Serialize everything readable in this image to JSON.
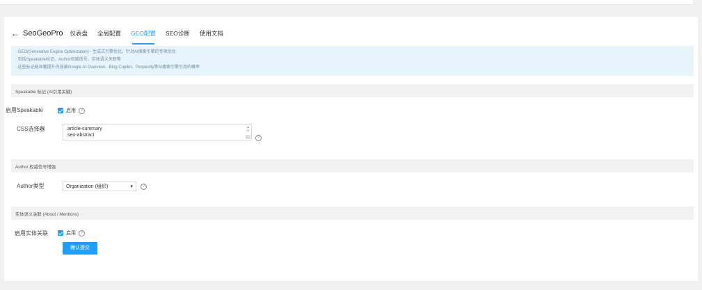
{
  "nav": {
    "back_icon": "←",
    "brand": "SeoGeoPro",
    "tabs": [
      {
        "label": "仪表盘",
        "active": false
      },
      {
        "label": "全局配置",
        "active": false
      },
      {
        "label": "GEO配置",
        "active": true
      },
      {
        "label": "SEO诊断",
        "active": false
      },
      {
        "label": "使用文档",
        "active": false
      }
    ]
  },
  "notice": {
    "lines": [
      "· GEO(Generative Engine Optimization) - 生成式引擎优化，针对AI搜索引擎的专项优化",
      "· 包括Speakable标记、Author权威信号、实体语义关联等",
      "· 这些标记能显著提升内容被Google AI Overview、Bing Copilot、Perplexity等AI搜索引擎引用的概率"
    ]
  },
  "speakable": {
    "section_title": "Speakable 标记 (AI引用关键)",
    "enable_label": "启用Speakable",
    "enable_checked": true,
    "enable_text": "启用",
    "css_label": "CSS选择器",
    "css_lines": [
      ".article-summary",
      ".seo-abstract"
    ]
  },
  "author": {
    "section_title": "Author 权威信号增强",
    "type_label": "Author类型",
    "type_value": "Organization (组织)"
  },
  "entity": {
    "section_title": "实体语义关联 (About / Mentions)",
    "enable_label": "启用实体关联",
    "enable_checked": true,
    "enable_text": "启用"
  },
  "submit_label": "确认提交",
  "help_glyph": "?",
  "accent_color": "#1e9fff"
}
